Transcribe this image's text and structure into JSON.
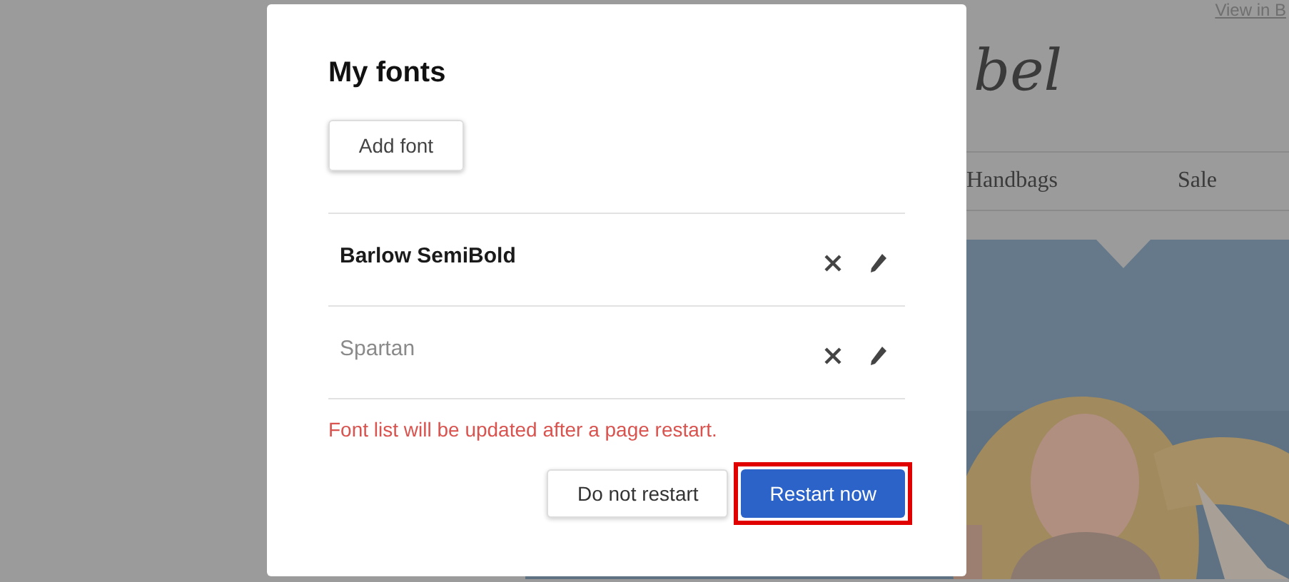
{
  "background_page": {
    "header_link": "View in B",
    "logo": "bel",
    "nav": [
      "Handbags",
      "Sale"
    ]
  },
  "dialog": {
    "title": "My fonts",
    "add_button": "Add font",
    "fonts": [
      {
        "name": "Barlow SemiBold",
        "kind": "bold"
      },
      {
        "name": "Spartan",
        "kind": "light"
      }
    ],
    "notice": "Font list will be updated after a page restart.",
    "buttons": [
      {
        "label": "Do not restart",
        "kind": "secondary"
      },
      {
        "label": "Restart now",
        "kind": "primary",
        "highlighted": true
      }
    ]
  }
}
